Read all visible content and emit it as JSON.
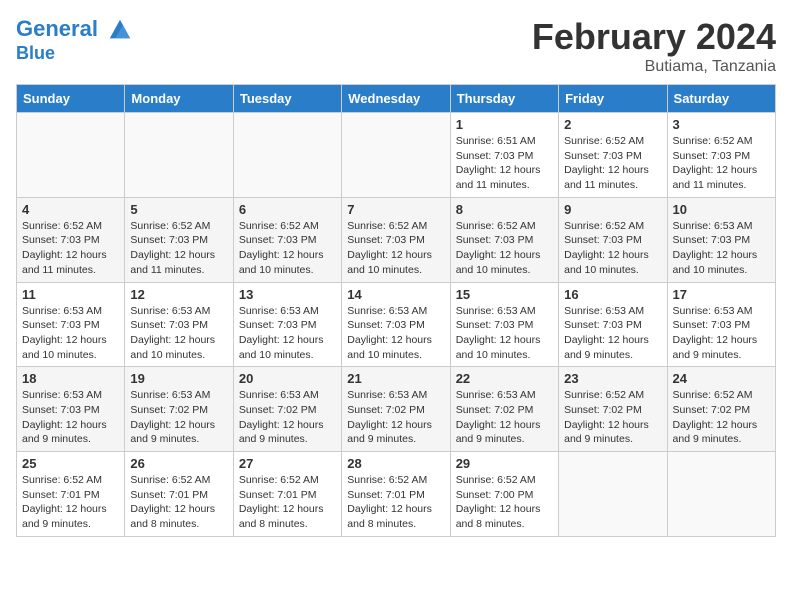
{
  "header": {
    "logo_line1": "General",
    "logo_line2": "Blue",
    "month_year": "February 2024",
    "location": "Butiama, Tanzania"
  },
  "weekdays": [
    "Sunday",
    "Monday",
    "Tuesday",
    "Wednesday",
    "Thursday",
    "Friday",
    "Saturday"
  ],
  "weeks": [
    [
      {
        "day": "",
        "info": ""
      },
      {
        "day": "",
        "info": ""
      },
      {
        "day": "",
        "info": ""
      },
      {
        "day": "",
        "info": ""
      },
      {
        "day": "1",
        "info": "Sunrise: 6:51 AM\nSunset: 7:03 PM\nDaylight: 12 hours\nand 11 minutes."
      },
      {
        "day": "2",
        "info": "Sunrise: 6:52 AM\nSunset: 7:03 PM\nDaylight: 12 hours\nand 11 minutes."
      },
      {
        "day": "3",
        "info": "Sunrise: 6:52 AM\nSunset: 7:03 PM\nDaylight: 12 hours\nand 11 minutes."
      }
    ],
    [
      {
        "day": "4",
        "info": "Sunrise: 6:52 AM\nSunset: 7:03 PM\nDaylight: 12 hours\nand 11 minutes."
      },
      {
        "day": "5",
        "info": "Sunrise: 6:52 AM\nSunset: 7:03 PM\nDaylight: 12 hours\nand 11 minutes."
      },
      {
        "day": "6",
        "info": "Sunrise: 6:52 AM\nSunset: 7:03 PM\nDaylight: 12 hours\nand 10 minutes."
      },
      {
        "day": "7",
        "info": "Sunrise: 6:52 AM\nSunset: 7:03 PM\nDaylight: 12 hours\nand 10 minutes."
      },
      {
        "day": "8",
        "info": "Sunrise: 6:52 AM\nSunset: 7:03 PM\nDaylight: 12 hours\nand 10 minutes."
      },
      {
        "day": "9",
        "info": "Sunrise: 6:52 AM\nSunset: 7:03 PM\nDaylight: 12 hours\nand 10 minutes."
      },
      {
        "day": "10",
        "info": "Sunrise: 6:53 AM\nSunset: 7:03 PM\nDaylight: 12 hours\nand 10 minutes."
      }
    ],
    [
      {
        "day": "11",
        "info": "Sunrise: 6:53 AM\nSunset: 7:03 PM\nDaylight: 12 hours\nand 10 minutes."
      },
      {
        "day": "12",
        "info": "Sunrise: 6:53 AM\nSunset: 7:03 PM\nDaylight: 12 hours\nand 10 minutes."
      },
      {
        "day": "13",
        "info": "Sunrise: 6:53 AM\nSunset: 7:03 PM\nDaylight: 12 hours\nand 10 minutes."
      },
      {
        "day": "14",
        "info": "Sunrise: 6:53 AM\nSunset: 7:03 PM\nDaylight: 12 hours\nand 10 minutes."
      },
      {
        "day": "15",
        "info": "Sunrise: 6:53 AM\nSunset: 7:03 PM\nDaylight: 12 hours\nand 10 minutes."
      },
      {
        "day": "16",
        "info": "Sunrise: 6:53 AM\nSunset: 7:03 PM\nDaylight: 12 hours\nand 9 minutes."
      },
      {
        "day": "17",
        "info": "Sunrise: 6:53 AM\nSunset: 7:03 PM\nDaylight: 12 hours\nand 9 minutes."
      }
    ],
    [
      {
        "day": "18",
        "info": "Sunrise: 6:53 AM\nSunset: 7:03 PM\nDaylight: 12 hours\nand 9 minutes."
      },
      {
        "day": "19",
        "info": "Sunrise: 6:53 AM\nSunset: 7:02 PM\nDaylight: 12 hours\nand 9 minutes."
      },
      {
        "day": "20",
        "info": "Sunrise: 6:53 AM\nSunset: 7:02 PM\nDaylight: 12 hours\nand 9 minutes."
      },
      {
        "day": "21",
        "info": "Sunrise: 6:53 AM\nSunset: 7:02 PM\nDaylight: 12 hours\nand 9 minutes."
      },
      {
        "day": "22",
        "info": "Sunrise: 6:53 AM\nSunset: 7:02 PM\nDaylight: 12 hours\nand 9 minutes."
      },
      {
        "day": "23",
        "info": "Sunrise: 6:52 AM\nSunset: 7:02 PM\nDaylight: 12 hours\nand 9 minutes."
      },
      {
        "day": "24",
        "info": "Sunrise: 6:52 AM\nSunset: 7:02 PM\nDaylight: 12 hours\nand 9 minutes."
      }
    ],
    [
      {
        "day": "25",
        "info": "Sunrise: 6:52 AM\nSunset: 7:01 PM\nDaylight: 12 hours\nand 9 minutes."
      },
      {
        "day": "26",
        "info": "Sunrise: 6:52 AM\nSunset: 7:01 PM\nDaylight: 12 hours\nand 8 minutes."
      },
      {
        "day": "27",
        "info": "Sunrise: 6:52 AM\nSunset: 7:01 PM\nDaylight: 12 hours\nand 8 minutes."
      },
      {
        "day": "28",
        "info": "Sunrise: 6:52 AM\nSunset: 7:01 PM\nDaylight: 12 hours\nand 8 minutes."
      },
      {
        "day": "29",
        "info": "Sunrise: 6:52 AM\nSunset: 7:00 PM\nDaylight: 12 hours\nand 8 minutes."
      },
      {
        "day": "",
        "info": ""
      },
      {
        "day": "",
        "info": ""
      }
    ]
  ]
}
